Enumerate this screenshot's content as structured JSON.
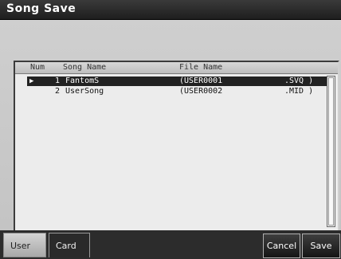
{
  "window": {
    "title": "Song Save"
  },
  "list": {
    "columns": {
      "num": "Num",
      "song_name": "Song Name",
      "file_name": "File Name"
    },
    "rows": [
      {
        "num": "1",
        "song_name": "FantomS",
        "file_name": "(USER0001",
        "ext": ".SVQ )",
        "selected": true
      },
      {
        "num": "2",
        "song_name": "UserSong",
        "file_name": "(USER0002",
        "ext": ".MID )",
        "selected": false
      }
    ],
    "cursor_icon": "triangle-right-icon"
  },
  "tabs": [
    {
      "label": "User",
      "active": true
    },
    {
      "label": "Card",
      "active": false
    }
  ],
  "buttons": {
    "cancel": "Cancel",
    "save": "Save"
  }
}
